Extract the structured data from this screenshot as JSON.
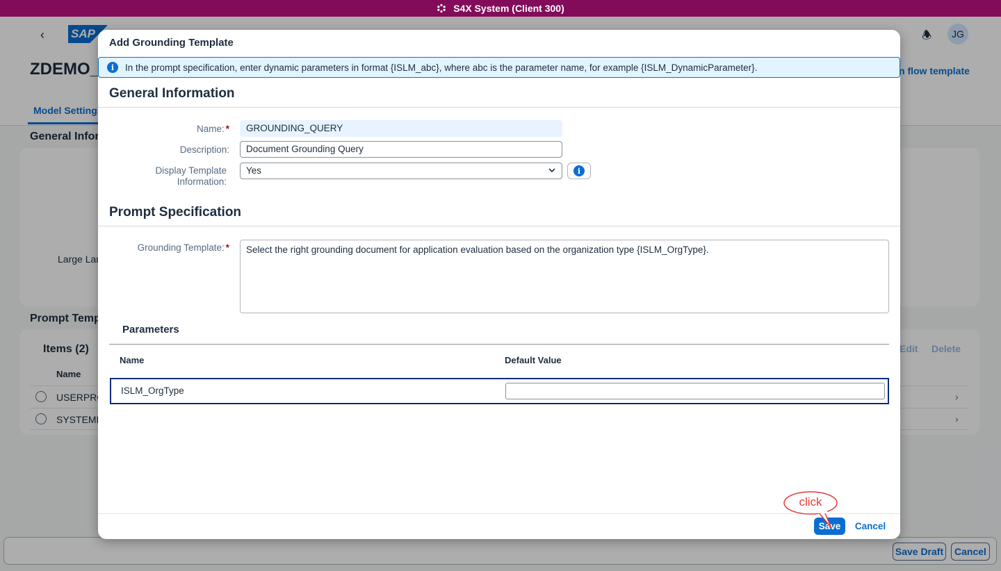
{
  "shell": {
    "title": "S4X System (Client 300)"
  },
  "background": {
    "logo": "SAP",
    "page_title": "ZDEMO_",
    "tab_model_settings": "Model Settings",
    "flow_template_link": "n flow template",
    "avatar_initials": "JG",
    "general_info_heading": "General Inform",
    "large_language_label": "Large Lan",
    "prompt_templates_heading": "Prompt Temp",
    "items_heading": "Items (2)",
    "edit_label": "Edit",
    "delete_label": "Delete",
    "col_name": "Name",
    "rows": [
      "USERPRO",
      "SYSTEMP"
    ],
    "save_draft": "Save Draft",
    "cancel": "Cancel"
  },
  "dialog": {
    "title": "Add Grounding Template",
    "info_message": "In the prompt specification, enter dynamic parameters in format {ISLM_abc}, where abc is the parameter name, for example {ISLM_DynamicParameter}.",
    "general_info_title": "General Information",
    "name_label": "Name:",
    "name_value": "GROUNDING_QUERY",
    "description_label": "Description:",
    "description_value": "Document Grounding Query",
    "display_template_label_1": "Display Template",
    "display_template_label_2": "Information:",
    "display_template_value": "Yes",
    "prompt_spec_title": "Prompt Specification",
    "grounding_template_label": "Grounding Template:",
    "grounding_template_value": "Select the right grounding document for application evaluation based on the organization type {ISLM_OrgType}.",
    "parameters_title": "Parameters",
    "col_name": "Name",
    "col_default_value": "Default Value",
    "parameters": [
      {
        "name": "ISLM_OrgType",
        "default_value": ""
      }
    ],
    "save_label": "Save",
    "cancel_label": "Cancel"
  },
  "annotation": {
    "callout_text": "click"
  }
}
